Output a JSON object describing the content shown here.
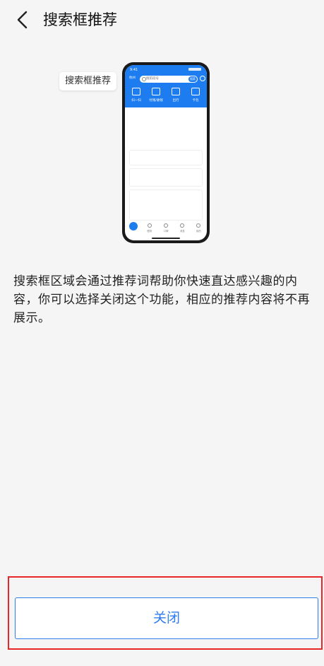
{
  "header": {
    "title": "搜索框推荐",
    "back_icon": "chevron-left-icon"
  },
  "illustration": {
    "tooltip": "搜索框推荐",
    "status_time": "9:41",
    "city": "杭州",
    "search_placeholder": "搜航班号",
    "search_button": "搜索",
    "grid_items": [
      "扫一扫",
      "付钱/收钱",
      "出行",
      "卡包"
    ],
    "tab_items": [
      "",
      "理财",
      "口碑",
      "消息",
      "我的"
    ]
  },
  "description": "搜索框区域会通过推荐词帮助你快速直达感兴趣的内容，你可以选择关闭这个功能，相应的推荐内容将不再展示。",
  "footer": {
    "close_label": "关闭"
  },
  "colors": {
    "accent": "#2f7bf0",
    "highlight": "#e8262a",
    "phone_header": "#1c7cf0"
  }
}
